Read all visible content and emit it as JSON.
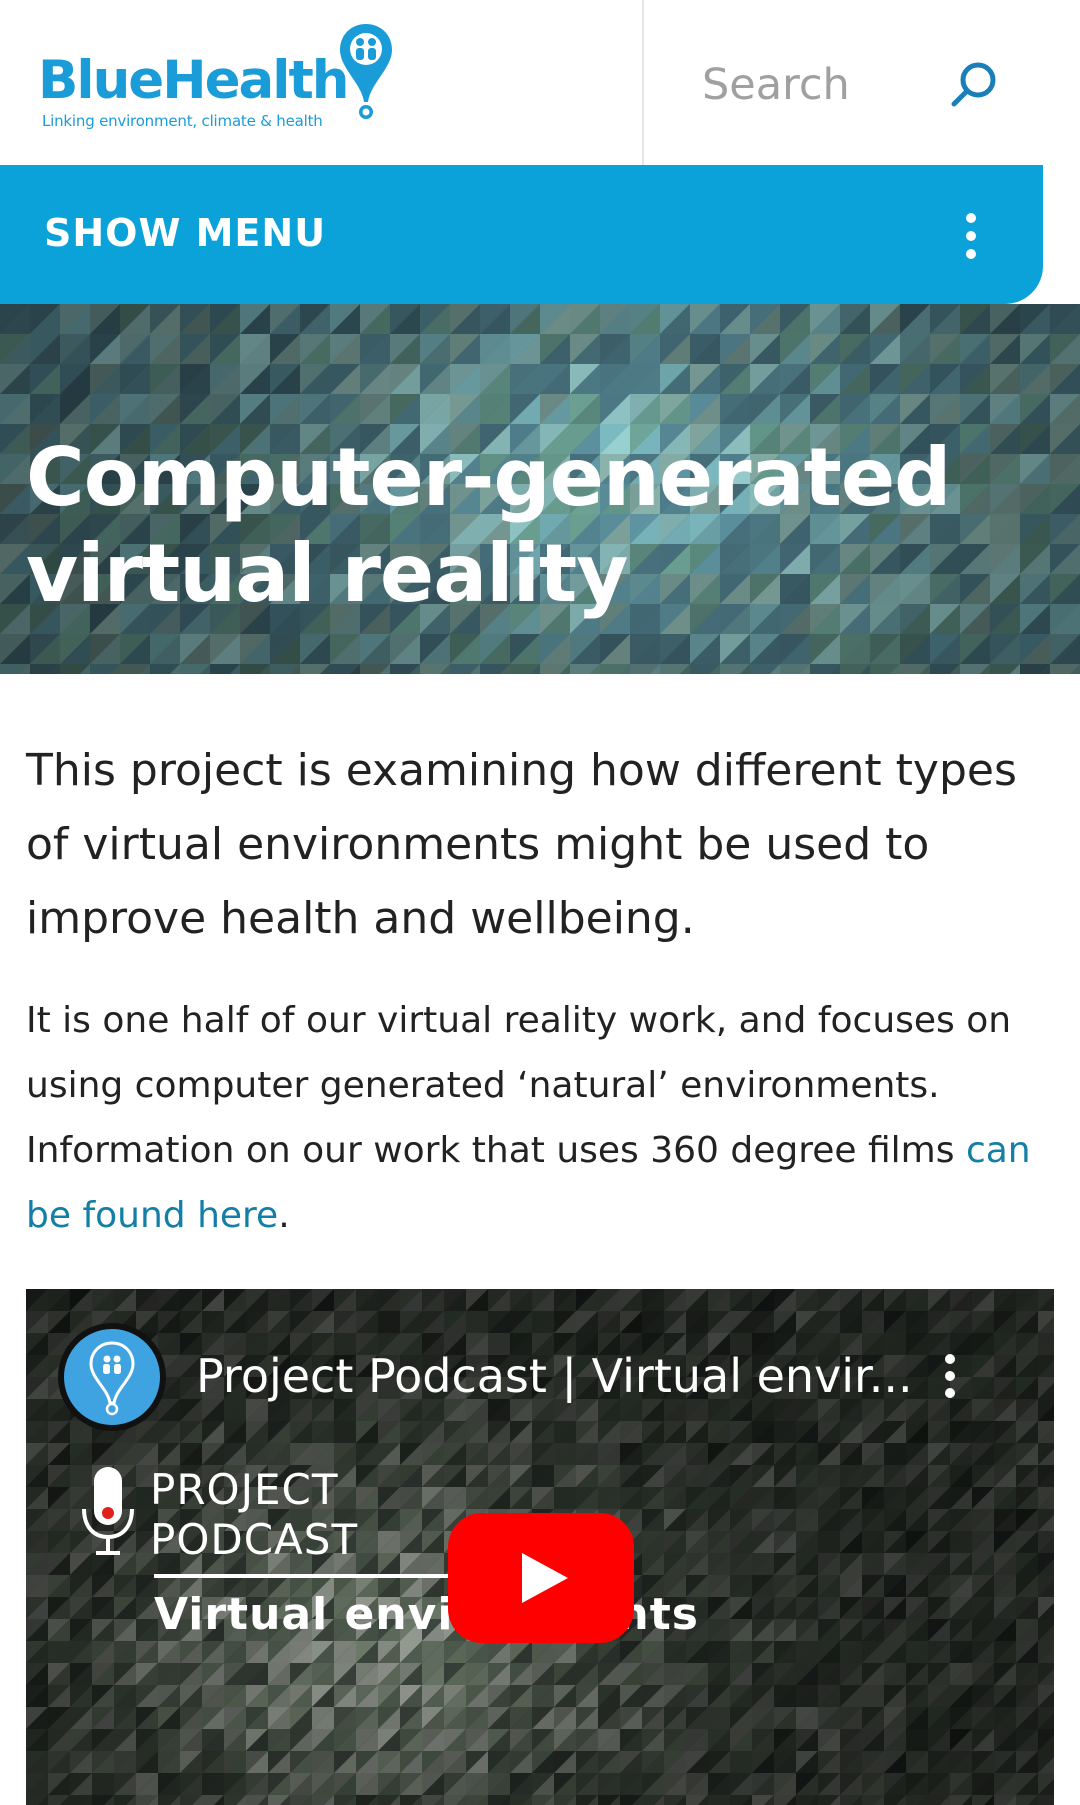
{
  "header": {
    "logo_text": "BlueHealth",
    "logo_tagline": "Linking environment, climate & health",
    "search_placeholder": "Search"
  },
  "menu": {
    "label": "SHOW MENU"
  },
  "hero": {
    "title_line1": "Computer-generated",
    "title_line2": "virtual reality"
  },
  "content": {
    "intro": "This project is examining how different types of virtual environments might be used to improve health and wellbeing.",
    "body_prefix": "It is one half of our virtual reality work, and focuses on using computer generated ‘natural’ environments. Information on our work that uses 360 degree films ",
    "body_link": "can be found here",
    "body_suffix": "."
  },
  "video": {
    "title": "Project Podcast | Virtual envir...",
    "podcast_line1": "PROJECT",
    "podcast_line2": "PODCAST",
    "podcast_subtitle": "Virtual environments"
  },
  "colors": {
    "brand_blue": "#1a9cd8",
    "menu_bar": "#0aa2d8",
    "link": "#137fa6",
    "youtube_red": "#ff0000"
  },
  "icons": [
    "logo-pin-icon",
    "search-icon",
    "kebab-menu-icon",
    "microphone-icon",
    "play-icon"
  ]
}
